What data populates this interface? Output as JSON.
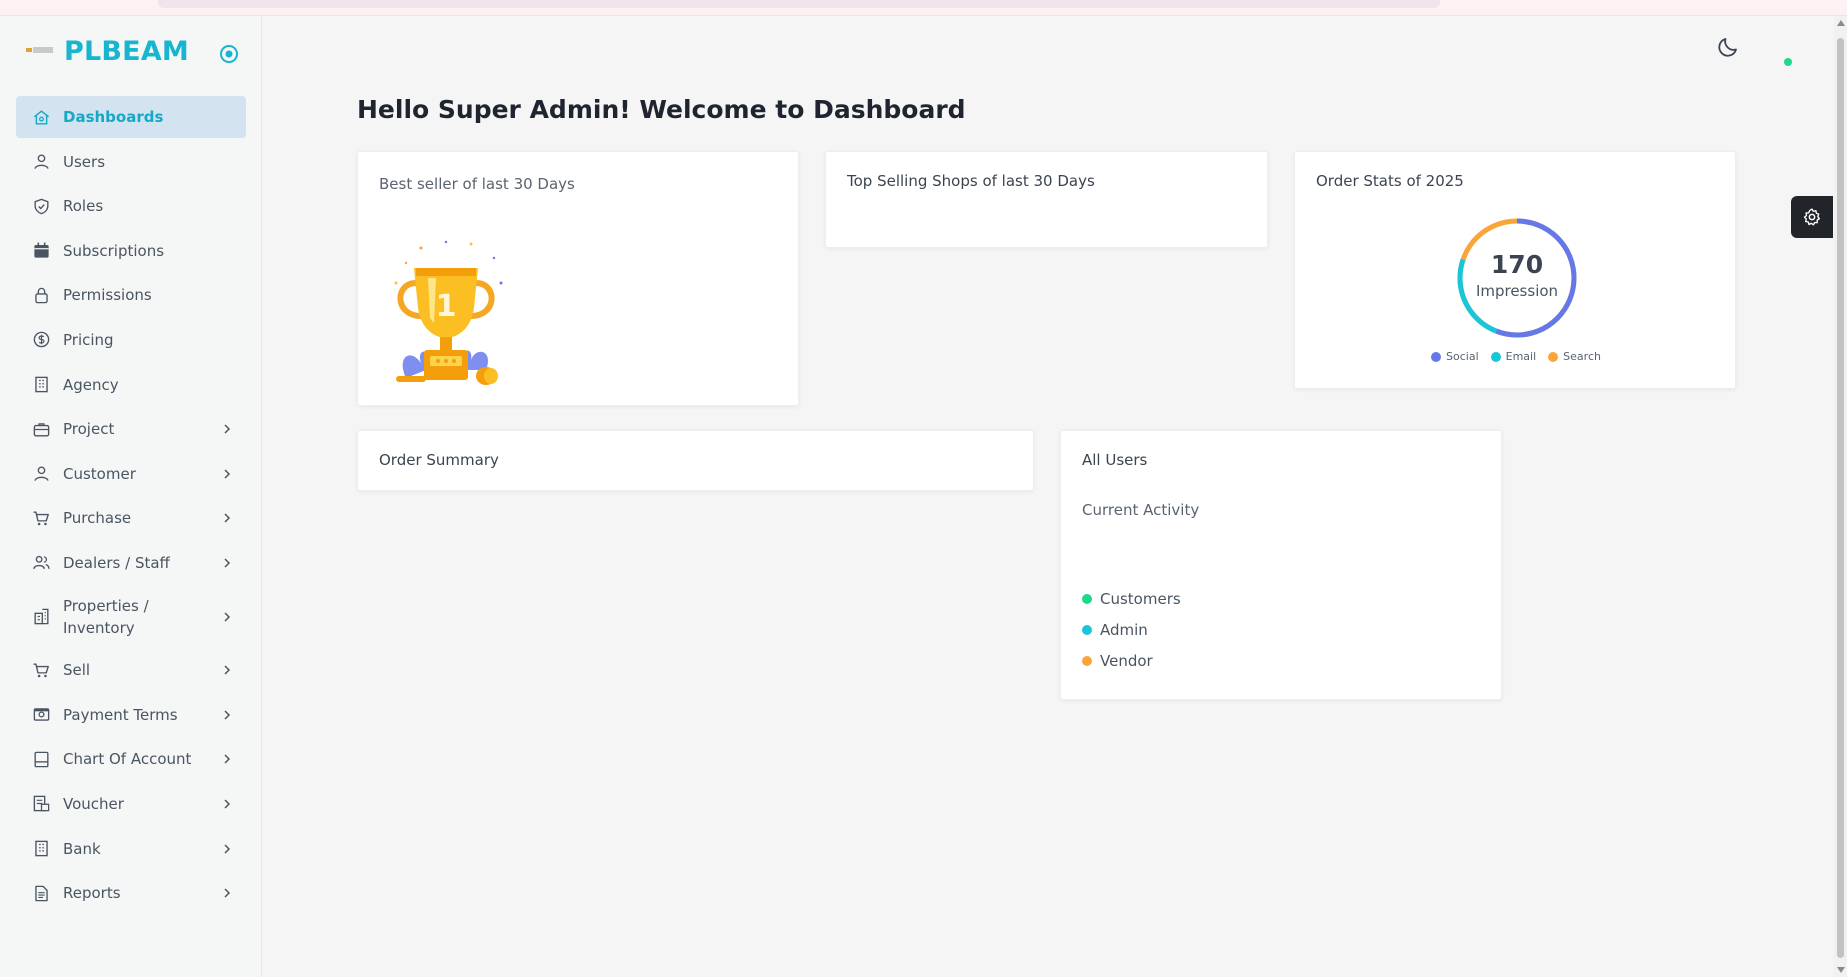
{
  "brand": {
    "name": "PLBEAM",
    "logo_text": "PLBEAM"
  },
  "sidebar": {
    "items": [
      {
        "label": "Dashboards",
        "icon": "home-icon",
        "active": true,
        "has_children": false
      },
      {
        "label": "Users",
        "icon": "user-icon",
        "active": false,
        "has_children": false
      },
      {
        "label": "Roles",
        "icon": "shield-check-icon",
        "active": false,
        "has_children": false
      },
      {
        "label": "Subscriptions",
        "icon": "calendar-icon",
        "active": false,
        "has_children": false
      },
      {
        "label": "Permissions",
        "icon": "lock-icon",
        "active": false,
        "has_children": false
      },
      {
        "label": "Pricing",
        "icon": "dollar-circle-icon",
        "active": false,
        "has_children": false
      },
      {
        "label": "Agency",
        "icon": "building-icon",
        "active": false,
        "has_children": false
      },
      {
        "label": "Project",
        "icon": "briefcase-icon",
        "active": false,
        "has_children": true
      },
      {
        "label": "Customer",
        "icon": "user-icon",
        "active": false,
        "has_children": true
      },
      {
        "label": "Purchase",
        "icon": "cart-icon",
        "active": false,
        "has_children": true
      },
      {
        "label": "Dealers / Staff",
        "icon": "users-icon",
        "active": false,
        "has_children": true
      },
      {
        "label": "Properties / Inventory",
        "icon": "buildings-icon",
        "active": false,
        "has_children": true
      },
      {
        "label": "Sell",
        "icon": "cart-icon",
        "active": false,
        "has_children": true
      },
      {
        "label": "Payment Terms",
        "icon": "cash-icon",
        "active": false,
        "has_children": true
      },
      {
        "label": "Chart Of Account",
        "icon": "ledger-icon",
        "active": false,
        "has_children": true
      },
      {
        "label": "Voucher",
        "icon": "receipt-icon",
        "active": false,
        "has_children": true
      },
      {
        "label": "Bank",
        "icon": "building-icon",
        "active": false,
        "has_children": true
      },
      {
        "label": "Reports",
        "icon": "report-icon",
        "active": false,
        "has_children": true
      }
    ]
  },
  "header": {
    "theme_toggle_icon": "moon-icon",
    "status": "online"
  },
  "main": {
    "title": "Hello Super Admin! Welcome to Dashboard",
    "best_seller": {
      "title": "Best seller of last 30 Days",
      "trophy_number": "1"
    },
    "top_shops": {
      "title": "Top Selling Shops of last 30 Days"
    },
    "order_stats": {
      "title": "Order Stats of 2025",
      "value": "170",
      "value_label": "Impression",
      "legend": [
        {
          "label": "Social",
          "color": "#6478ea"
        },
        {
          "label": "Email",
          "color": "#18c6d9"
        },
        {
          "label": "Search",
          "color": "#f9a53a"
        }
      ]
    },
    "order_summary": {
      "title": "Order Summary"
    },
    "all_users": {
      "title": "All Users",
      "subtitle": "Current Activity",
      "legend": [
        {
          "label": "Customers",
          "color": "#1ed98a"
        },
        {
          "label": "Admin",
          "color": "#18c6d9"
        },
        {
          "label": "Vendor",
          "color": "#f9a53a"
        }
      ]
    }
  },
  "colors": {
    "accent": "#17b5d0",
    "active_bg": "#d4e3f0"
  }
}
